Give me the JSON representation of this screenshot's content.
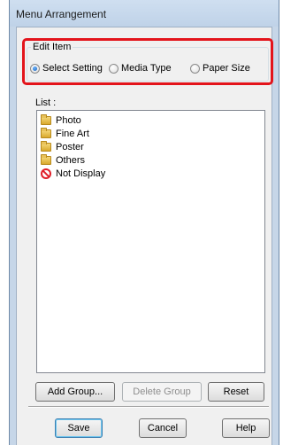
{
  "window": {
    "title": "Menu Arrangement"
  },
  "edit_item": {
    "legend": "Edit Item",
    "options": [
      {
        "label": "Select Setting",
        "selected": true
      },
      {
        "label": "Media Type",
        "selected": false
      },
      {
        "label": "Paper Size",
        "selected": false
      }
    ]
  },
  "list": {
    "label": "List :",
    "items": [
      {
        "label": "Photo",
        "icon": "folder-icon"
      },
      {
        "label": "Fine Art",
        "icon": "folder-icon"
      },
      {
        "label": "Poster",
        "icon": "folder-icon"
      },
      {
        "label": "Others",
        "icon": "folder-icon"
      },
      {
        "label": "Not Display",
        "icon": "no-entry-icon"
      }
    ]
  },
  "list_buttons": {
    "add_group": "Add Group...",
    "delete_group": "Delete Group",
    "reset": "Reset"
  },
  "dialog_buttons": {
    "save": "Save",
    "cancel": "Cancel",
    "help": "Help"
  },
  "colors": {
    "highlight_border": "#e3141b",
    "window_frame": "#c6d6e8"
  }
}
